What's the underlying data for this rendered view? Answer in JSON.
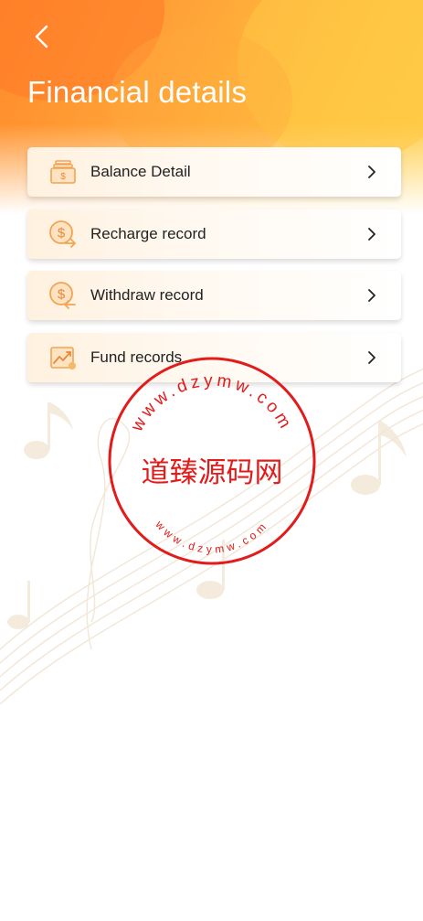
{
  "header": {
    "title": "Financial details",
    "back_icon": "chevron-left-icon"
  },
  "menu": {
    "items": [
      {
        "label": "Balance Detail",
        "icon": "wallet-icon"
      },
      {
        "label": "Recharge record",
        "icon": "dollar-recharge-icon"
      },
      {
        "label": "Withdraw record",
        "icon": "dollar-withdraw-icon"
      },
      {
        "label": "Fund records",
        "icon": "chart-up-icon"
      }
    ],
    "chevron_icon": "chevron-right-icon"
  },
  "watermark": {
    "main_text": "道臻源码网",
    "top_arc": "www.dzymw.com",
    "bottom_arc": "www.dzymw.com"
  },
  "colors": {
    "accent": "#ff9a30",
    "icon": "#f2a452",
    "stamp": "#e21b1b"
  }
}
